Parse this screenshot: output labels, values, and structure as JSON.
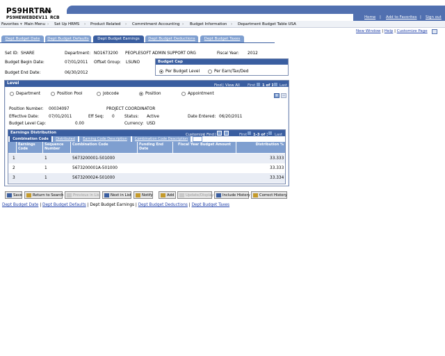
{
  "header": {
    "title": "PS9HRTRN",
    "version": "8.50",
    "subtitle": "PS9HEWEBDEV11",
    "subtitle2": "RCB",
    "links": [
      "Home",
      "Add to Favorites",
      "Sign out"
    ]
  },
  "breadcrumb": [
    "Favorites",
    "Main Menu",
    "Set Up HRMS",
    "Product Related",
    "Commitment Accounting",
    "Budget Information",
    "Department Budget Table USA"
  ],
  "page_links": [
    "New Window",
    "Help",
    "Customize Page"
  ],
  "tabs": [
    "Dept Budget Date",
    "Dept Budget Defaults",
    "Dept Budget Earnings",
    "Dept Budget Deductions",
    "Dept Budget Taxes"
  ],
  "form": {
    "setid_label": "Set ID:",
    "setid": "SHARE",
    "dept_label": "Department:",
    "dept_code": "NO1673200",
    "dept_name": "PEOPLESOFT ADMIN SUPPORT ORG",
    "fy_label": "Fiscal Year:",
    "fy": "2012",
    "begin_label": "Budget Begin Date:",
    "begin": "07/01/2011",
    "offset_label": "Offset Group:",
    "offset": "LSUNO",
    "end_label": "Budget End Date:",
    "end": "06/30/2012"
  },
  "budget_cap": {
    "title": "Budget Cap",
    "options": [
      "Per Budget Level",
      "Per Earn/Tax/Ded"
    ],
    "selected": "Per Budget Level"
  },
  "level": {
    "title": "Level",
    "nav": {
      "find": "Find",
      "view_all": "View All",
      "first": "First",
      "count": "1 of 1",
      "last": "Last"
    },
    "options": [
      "Department",
      "Position Pool",
      "Jobcode",
      "Position",
      "Appointment"
    ],
    "selected": "Position",
    "position_label": "Position Number:",
    "position_number": "00034097",
    "position_title": "PROJECT COORDINATOR",
    "eff_label": "Effective Date:",
    "eff": "07/01/2011",
    "seq_label": "Eff Seq:",
    "seq": "0",
    "status_label": "Status:",
    "status": "Active",
    "entered_label": "Date Entered:",
    "entered": "06/20/2011",
    "cap_label": "Budget Level Cap:",
    "cap": "0.00",
    "currency_label": "Currency:",
    "currency": "USD"
  },
  "grid": {
    "title": "Earnings Distribution",
    "nav": {
      "customize": "Customize",
      "find": "Find",
      "first": "First",
      "count": "1-3 of 3",
      "last": "Last"
    },
    "tabs": [
      "Combination Code",
      "Distributed",
      "Earning Code Description",
      "Combination Code Description"
    ],
    "columns": [
      "Earnings Code",
      "Sequence Number",
      "Combination Code",
      "Funding End Date",
      "Fiscal Year Budget Amount",
      "Distribution %"
    ],
    "rows": [
      {
        "n": "1",
        "earn": "",
        "seq": "1",
        "combo": "5673200001-501000",
        "fund_end": "",
        "amount": "",
        "dist": "33.333"
      },
      {
        "n": "2",
        "earn": "",
        "seq": "1",
        "combo": "5673200001A-501000",
        "fund_end": "",
        "amount": "",
        "dist": "33.333"
      },
      {
        "n": "3",
        "earn": "",
        "seq": "1",
        "combo": "5673200024-501000",
        "fund_end": "",
        "amount": "",
        "dist": "33.334"
      }
    ]
  },
  "buttons": [
    "Save",
    "Return to Search",
    "Previous in List",
    "Next in List",
    "Notify",
    "Add",
    "Update/Display",
    "Include History",
    "Correct History"
  ],
  "bottom_links": [
    "Dept Budget Date",
    "Dept Budget Defaults",
    "Dept Budget Earnings",
    "Dept Budget Deductions",
    "Dept Budget Taxes"
  ]
}
